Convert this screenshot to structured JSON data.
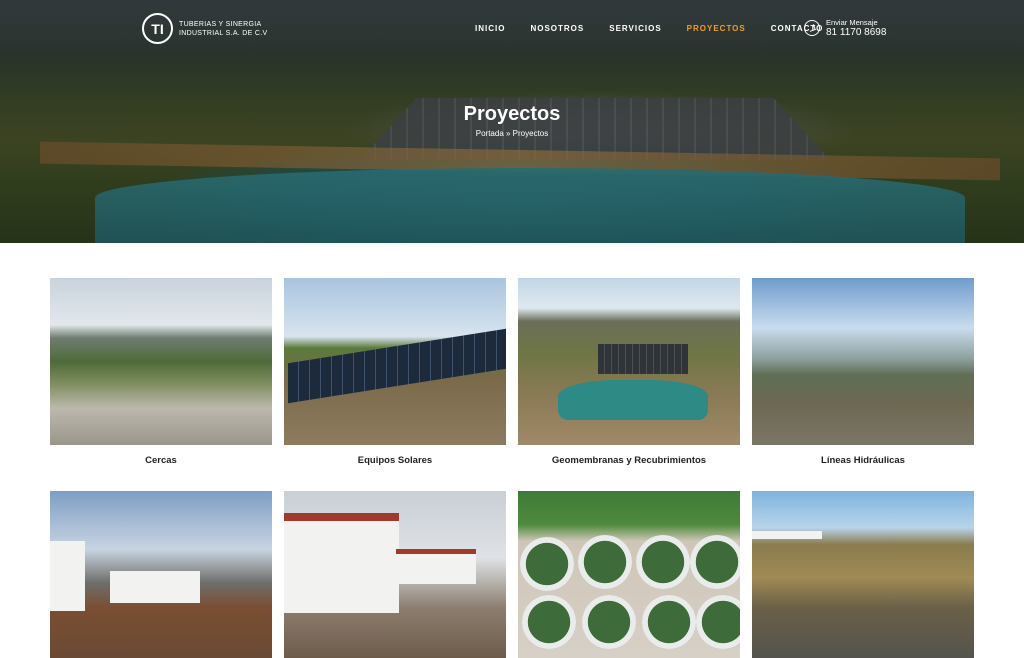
{
  "brand": {
    "logo_mark": "TI",
    "name_line1": "TUBERIAS Y SINERGIA",
    "name_line2": "INDUSTRIAL S.A. DE C.V"
  },
  "nav": {
    "items": [
      {
        "label": "INICIO",
        "active": false
      },
      {
        "label": "NOSOTROS",
        "active": false
      },
      {
        "label": "SERVICIOS",
        "active": false
      },
      {
        "label": "PROYECTOS",
        "active": true
      },
      {
        "label": "CONTACTO",
        "active": false
      }
    ],
    "whatsapp_label": "Enviar Mensaje",
    "whatsapp_number": "81 1170 8698"
  },
  "hero": {
    "title": "Proyectos",
    "breadcrumb": "Portada » Proyectos"
  },
  "projects": [
    {
      "caption": "Cercas"
    },
    {
      "caption": "Equipos Solares"
    },
    {
      "caption": "Geomembranas y Recubrimientos"
    },
    {
      "caption": "Líneas Hidráulicas"
    },
    {
      "caption": ""
    },
    {
      "caption": ""
    },
    {
      "caption": ""
    },
    {
      "caption": ""
    }
  ],
  "colors": {
    "accent": "#f29b2c",
    "text": "#222222"
  }
}
